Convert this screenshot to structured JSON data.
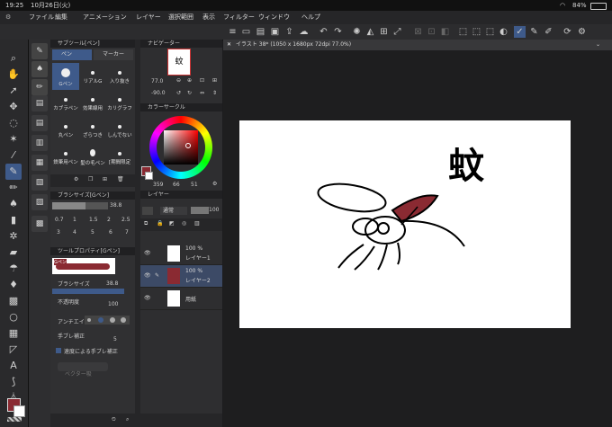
{
  "status": {
    "time": "19:25",
    "date": "10月26日(火)",
    "battery": "84%"
  },
  "menu": [
    "ファイル",
    "編集",
    "アニメーション",
    "レイヤー",
    "選択範囲",
    "表示",
    "フィルター",
    "ウィンドウ",
    "ヘルプ"
  ],
  "subtool": {
    "title": "サブツール[ペン]",
    "tab_pen": "ペン",
    "tab_marker": "マーカー",
    "brushes": [
      "Gペン",
      "リアルG",
      "入り抜き",
      "カブラペン",
      "効果線用",
      "カリグラフ",
      "丸ペン",
      "ざらつき",
      "しんでない",
      "鉄筆用ペン",
      "髪の毛ペン",
      "[期間限定"
    ]
  },
  "brushsize": {
    "title": "ブラシサイズ[Gペン]",
    "value": "38.8",
    "sizes": [
      "0.7",
      "1",
      "1.5",
      "2",
      "2.5",
      "3",
      "4",
      "5",
      "6",
      "7"
    ]
  },
  "toolprop": {
    "title": "ツールプロパティ[Gペン]",
    "preview_label": "Gペン",
    "brush_size_label": "ブラシサイズ",
    "brush_size_value": "38.8",
    "opacity_label": "不透明度",
    "opacity_value": "100",
    "antialias_label": "アンチエイ",
    "stabilization_label": "手ブレ補正",
    "stabilization_value": "5",
    "speed_label": "速度による手ブレ補正",
    "vector_label": "ベクター吸"
  },
  "navigator": {
    "title": "ナビゲーター",
    "zoom": "77.0",
    "angle": "-90.0"
  },
  "colorcircle": {
    "title": "カラーサークル",
    "h": "359",
    "s": "66",
    "v": "51",
    "main_color": "#8a2a32"
  },
  "layer": {
    "title": "レイヤー",
    "blend": "通常",
    "opacity": "100",
    "rows": [
      {
        "pct": "100 %",
        "mode": "通常",
        "name": "レイヤー1"
      },
      {
        "pct": "100 %",
        "mode": "通常",
        "name": "レイヤー2"
      },
      {
        "pct": "",
        "mode": "",
        "name": "用紙"
      }
    ]
  },
  "canvas": {
    "tab_title": "イラスト 38* (1050 x 1680px 72dpi 77.0%)",
    "kanji": "蚊"
  }
}
